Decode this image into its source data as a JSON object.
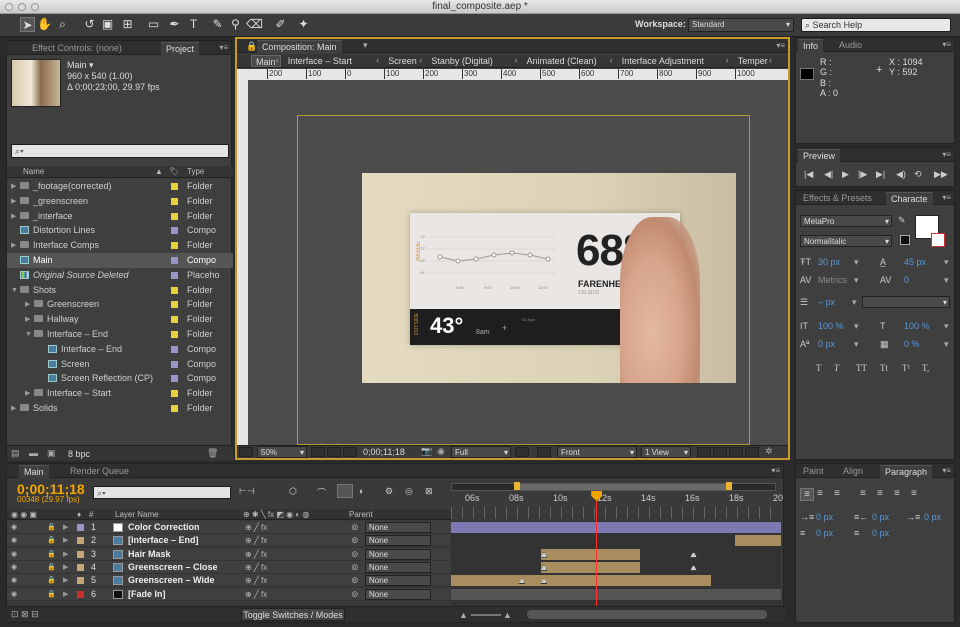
{
  "window": {
    "title": "final_composite.aep *"
  },
  "toolbar": {
    "tools": [
      "arrow-tool",
      "hand-tool",
      "zoom-tool",
      "rotate-tool",
      "camera-tool",
      "pan-behind-tool",
      "rectangle-tool",
      "pen-tool",
      "type-tool",
      "brush-tool",
      "clone-stamp-tool",
      "eraser-tool",
      "roto-brush-tool",
      "puppet-pin-tool"
    ],
    "workspace_label": "Workspace:",
    "workspace_value": "Standard",
    "search_placeholder": "Search Help"
  },
  "project_panel": {
    "tabs": [
      "Effect Controls: (none)",
      "Project"
    ],
    "item_name": "Main ▾",
    "item_size": "960 x 540 (1.00)",
    "item_duration": "Δ 0;00;23;00, 29.97 fps",
    "search_icon_label": "⌕▾",
    "col_name": "Name",
    "col_type": "Type",
    "items": [
      {
        "name": "_footage(corrected)",
        "type": "Folder",
        "indent": 0,
        "kind": "folder",
        "expand": "▶",
        "color": "#e6d23c"
      },
      {
        "name": "_greenscreen",
        "type": "Folder",
        "indent": 0,
        "kind": "folder",
        "expand": "▶",
        "color": "#e6d23c"
      },
      {
        "name": "_interface",
        "type": "Folder",
        "indent": 0,
        "kind": "folder",
        "expand": "▶",
        "color": "#e6d23c"
      },
      {
        "name": "Distortion Lines",
        "type": "Compo",
        "indent": 0,
        "kind": "comp",
        "expand": "",
        "color": "#9a95c9"
      },
      {
        "name": "Interface Comps",
        "type": "Folder",
        "indent": 0,
        "kind": "folder",
        "expand": "▶",
        "color": "#e6d23c"
      },
      {
        "name": "Main",
        "type": "Compo",
        "indent": 0,
        "kind": "comp",
        "expand": "",
        "color": "#9a95c9",
        "selected": true
      },
      {
        "name": "Original Source Deleted",
        "type": "Placeho",
        "indent": 0,
        "kind": "placeholder",
        "expand": "",
        "color": "#9a95c9",
        "italic": true
      },
      {
        "name": "Shots",
        "type": "Folder",
        "indent": 0,
        "kind": "folder",
        "expand": "▼",
        "color": "#e6d23c"
      },
      {
        "name": "Greenscreen",
        "type": "Folder",
        "indent": 1,
        "kind": "folder",
        "expand": "▶",
        "color": "#e6d23c"
      },
      {
        "name": "Hallway",
        "type": "Folder",
        "indent": 1,
        "kind": "folder",
        "expand": "▶",
        "color": "#e6d23c"
      },
      {
        "name": "Interface – End",
        "type": "Folder",
        "indent": 1,
        "kind": "folder",
        "expand": "▼",
        "color": "#e6d23c"
      },
      {
        "name": "Interface – End",
        "type": "Compo",
        "indent": 2,
        "kind": "comp",
        "expand": "",
        "color": "#9a95c9"
      },
      {
        "name": "Screen",
        "type": "Compo",
        "indent": 2,
        "kind": "comp",
        "expand": "",
        "color": "#9a95c9"
      },
      {
        "name": "Screen Reflection (CP)",
        "type": "Compo",
        "indent": 2,
        "kind": "comp",
        "expand": "",
        "color": "#9a95c9"
      },
      {
        "name": "Interface – Start",
        "type": "Folder",
        "indent": 1,
        "kind": "folder",
        "expand": "▶",
        "color": "#e6d23c"
      },
      {
        "name": "Solids",
        "type": "Folder",
        "indent": 0,
        "kind": "folder",
        "expand": "▶",
        "color": "#e6d23c"
      }
    ],
    "bpc": "8 bpc"
  },
  "composition": {
    "tab_label": "Composition: Main",
    "flow_tabs": [
      "Main",
      "Interface – Start",
      "Screen",
      "Stanby (Digital)",
      "Animated (Clean)",
      "Interface Adjustment",
      "Temper"
    ],
    "ruler_ticks": [
      "200",
      "100",
      "0",
      "100",
      "200",
      "300",
      "400",
      "500",
      "600",
      "700",
      "800",
      "900",
      "1000"
    ],
    "zoom": "50%",
    "timecode": "0;00;11;18",
    "resolution": "Full",
    "view": "Front",
    "views_count": "1 View",
    "screen_ui": {
      "side_label": "INSIDE",
      "axis_ticks": [
        "76°",
        "72°",
        "68°",
        "64°"
      ],
      "times": [
        "8:00",
        "9:00",
        "10:00",
        "11:00"
      ],
      "big_temp": "68°",
      "big_label": "FARENHEIGHT",
      "big_sub": "CELSIUS",
      "out_label": "OUTSIDE",
      "out_temp": "43°",
      "out_time": "8am",
      "out_next": "51 8pm"
    }
  },
  "info_panel": {
    "tabs": [
      "Info",
      "Audio"
    ],
    "r": "R :",
    "g": "G :",
    "b": "B :",
    "a": "A : 0",
    "x": "X : 1094",
    "y": "Y : 592"
  },
  "preview_panel": {
    "tab": "Preview"
  },
  "effects_panel": {
    "tabs": [
      "Effects & Presets",
      "Characte"
    ],
    "font": "MetaPro",
    "style": "NormalItalic",
    "size": "30 px",
    "leading": "45 px",
    "kerning": "Metrics",
    "tracking": "0",
    "stroke": "– px",
    "vscale": "100 %",
    "hscale": "100 %",
    "baseline": "0 px",
    "tsume": "0 %",
    "styles": [
      "T",
      "T",
      "TT",
      "Tt",
      "T¹",
      "T,"
    ]
  },
  "paragraph_panel": {
    "tabs": [
      "Paint",
      "Align",
      "Paragraph"
    ],
    "indent1": "0 px",
    "indent2": "0 px",
    "indent3": "0 px",
    "space1": "0 px",
    "space2": "0 px"
  },
  "timeline": {
    "tabs": [
      "Main",
      "Render Queue"
    ],
    "timecode": "0;00;11;18",
    "frame_info": "00348 (29.97 fps)",
    "col_num": "#",
    "col_layer": "Layer Name",
    "col_parent": "Parent",
    "ruler": [
      "06s",
      "08s",
      "10s",
      "12s",
      "14s",
      "16s",
      "18s",
      "20"
    ],
    "current_time_s": 11.6,
    "ruler_start_s": 5,
    "ruler_end_s": 20,
    "layers": [
      {
        "num": "1",
        "name": "Color Correction",
        "swatch": "#9a95c9",
        "parent": "None",
        "bar_color": "#7d79b3",
        "bar_start": 5,
        "bar_end": 20,
        "icon_color": "#ffffff"
      },
      {
        "num": "2",
        "name": "[Interface – End]",
        "swatch": "#c4a877",
        "parent": "None",
        "bar_color": "#a88d5e",
        "bar_start": 17.9,
        "bar_end": 20,
        "icon_color": "#4c7b9e"
      },
      {
        "num": "3",
        "name": "Hair Mask",
        "swatch": "#c4a877",
        "parent": "None",
        "bar_color": "#a88d5e",
        "bar_start": 9.1,
        "bar_end": 13.6,
        "icon_color": "#4c7b9e"
      },
      {
        "num": "4",
        "name": "Greenscreen – Close",
        "swatch": "#c4a877",
        "parent": "None",
        "bar_color": "#a88d5e",
        "bar_start": 9.1,
        "bar_end": 13.6,
        "icon_color": "#4c7b9e"
      },
      {
        "num": "5",
        "name": "Greenscreen – Wide",
        "swatch": "#c4a877",
        "parent": "None",
        "bar_color": "#a88d5e",
        "bar_start": 5,
        "bar_end": 16.8,
        "icon_color": "#4c7b9e"
      },
      {
        "num": "6",
        "name": "[Fade In]",
        "swatch": "#c83030",
        "parent": "None",
        "bar_color": "#555555",
        "bar_start": 5,
        "bar_end": 20,
        "icon_color": "#111111"
      }
    ],
    "toggle_label": "Toggle Switches / Modes"
  },
  "colors": {
    "accent": "#f2a500",
    "timeline_timecode": "#f2a500",
    "playhead": "#ff3030",
    "comp_border": "#c89a2a"
  }
}
